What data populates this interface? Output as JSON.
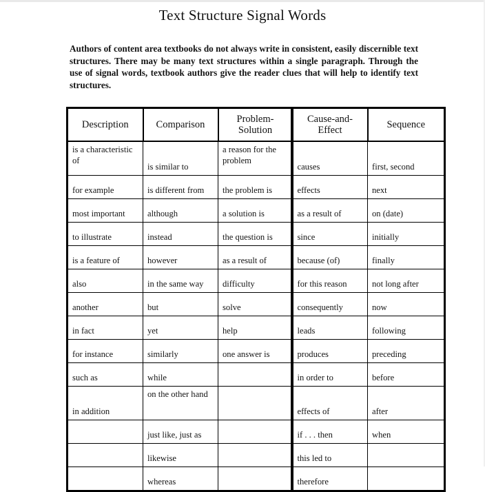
{
  "document": {
    "title": "Text Structure Signal Words",
    "intro": "Authors of content area textbooks do not always write in consistent, easily discernible text structures. There may be many text structures within a single paragraph. Through the use of signal words, textbook authors give the reader clues that will help to identify text structures."
  },
  "table": {
    "headers": [
      "Description",
      "Comparison",
      "Problem-Solution",
      "Cause-and-Effect",
      "Sequence"
    ],
    "rows": [
      [
        "is a characteristic of",
        "is similar to",
        "a reason for the problem",
        "causes",
        "first, second"
      ],
      [
        "for example",
        "is different from",
        "the problem is",
        "effects",
        "next"
      ],
      [
        "most important",
        "although",
        "a solution is",
        "as a result of",
        "on (date)"
      ],
      [
        "to illustrate",
        "instead",
        "the question is",
        "since",
        "initially"
      ],
      [
        "is a feature of",
        "however",
        "as a result of",
        "because (of)",
        "finally"
      ],
      [
        "also",
        "in the same way",
        "difficulty",
        "for this reason",
        "not long after"
      ],
      [
        "another",
        "but",
        "solve",
        "consequently",
        "now"
      ],
      [
        "in fact",
        "yet",
        "help",
        "leads",
        "following"
      ],
      [
        "for instance",
        "similarly",
        "one answer is",
        "produces",
        "preceding"
      ],
      [
        "such as",
        "while",
        "",
        "in order to",
        "before"
      ],
      [
        "in addition",
        "on the other hand",
        "",
        "effects of",
        "after"
      ],
      [
        "",
        "just like, just as",
        "",
        "if . . . then",
        "when"
      ],
      [
        "",
        "likewise",
        "",
        "this led to",
        ""
      ],
      [
        "",
        "whereas",
        "",
        "therefore",
        ""
      ]
    ]
  },
  "style": {
    "page_background": "#ffffff",
    "text_color": "#141414",
    "border_color": "#000000"
  }
}
